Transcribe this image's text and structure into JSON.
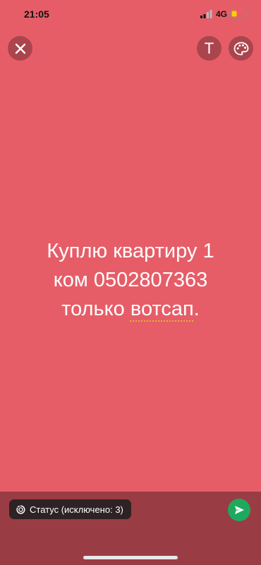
{
  "status_bar": {
    "time": "21:05",
    "network": "4G",
    "signal_icon": "signal-bars-icon",
    "battery_icon": "battery-low-icon",
    "battery_color": "#ffcc00"
  },
  "controls": {
    "close_icon": "close-icon",
    "text_tool_label": "T",
    "palette_icon": "palette-icon"
  },
  "status_post": {
    "background_color": "#e65d68",
    "lines": [
      "Куплю квартиру 1",
      "ком 0502807363"
    ],
    "line3_before": "только ",
    "line3_underlined": "вотсап",
    "line3_after": "."
  },
  "footer": {
    "audience_label": "Статус (исключено: 3)",
    "audience_icon": "status-ring-icon",
    "send_icon": "send-arrow-icon",
    "send_color": "#1fa95e"
  }
}
